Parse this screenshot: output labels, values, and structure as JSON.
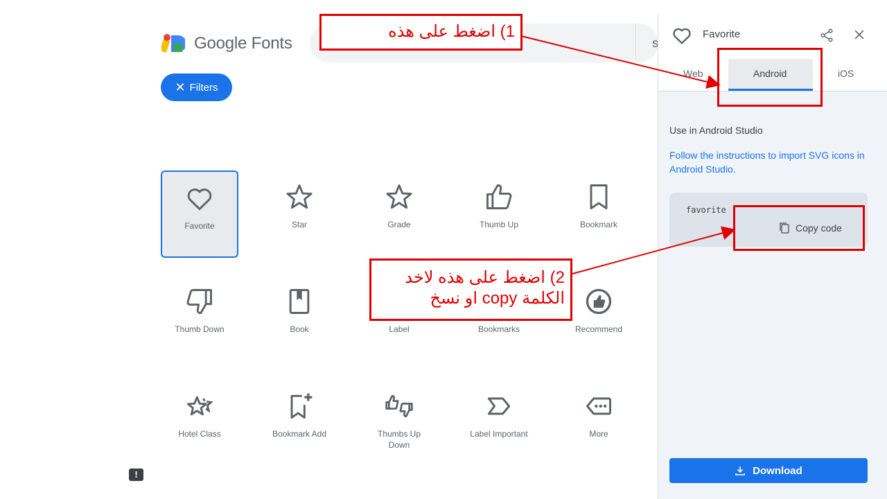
{
  "header": {
    "brand": "Google Fonts",
    "search_hint": "S"
  },
  "filters": {
    "label": "Filters"
  },
  "icons": [
    {
      "name": "Favorite"
    },
    {
      "name": "Star"
    },
    {
      "name": "Grade"
    },
    {
      "name": "Thumb Up"
    },
    {
      "name": "Bookmark"
    },
    {
      "name": "Thumb Down"
    },
    {
      "name": "Book"
    },
    {
      "name": "Label"
    },
    {
      "name": "Bookmarks"
    },
    {
      "name": "Recommend"
    },
    {
      "name": "Hotel Class"
    },
    {
      "name": "Bookmark Add"
    },
    {
      "name": "Thumbs Up Down"
    },
    {
      "name": "Label Important"
    },
    {
      "name": "More"
    }
  ],
  "selected_icon": "Favorite",
  "panel": {
    "title": "Favorite",
    "tabs": [
      {
        "label": "Web"
      },
      {
        "label": "Android"
      },
      {
        "label": "iOS"
      }
    ],
    "active_tab": "Android",
    "section_title": "Use in Android Studio",
    "instructions": "Follow the instructions to import SVG icons in Android Studio.",
    "code": "favorite",
    "copy_label": "Copy code",
    "download_label": "Download"
  },
  "annotations": {
    "callout1": "1) اضغط على هذه",
    "callout2_line1": "2) اضغط على هذه لاخد",
    "callout2_line2": "الكلمة copy او نسخ"
  },
  "colors": {
    "accent": "#1a73e8",
    "annotation_red": "#e00000",
    "panel_bg": "#f0f4f9"
  }
}
